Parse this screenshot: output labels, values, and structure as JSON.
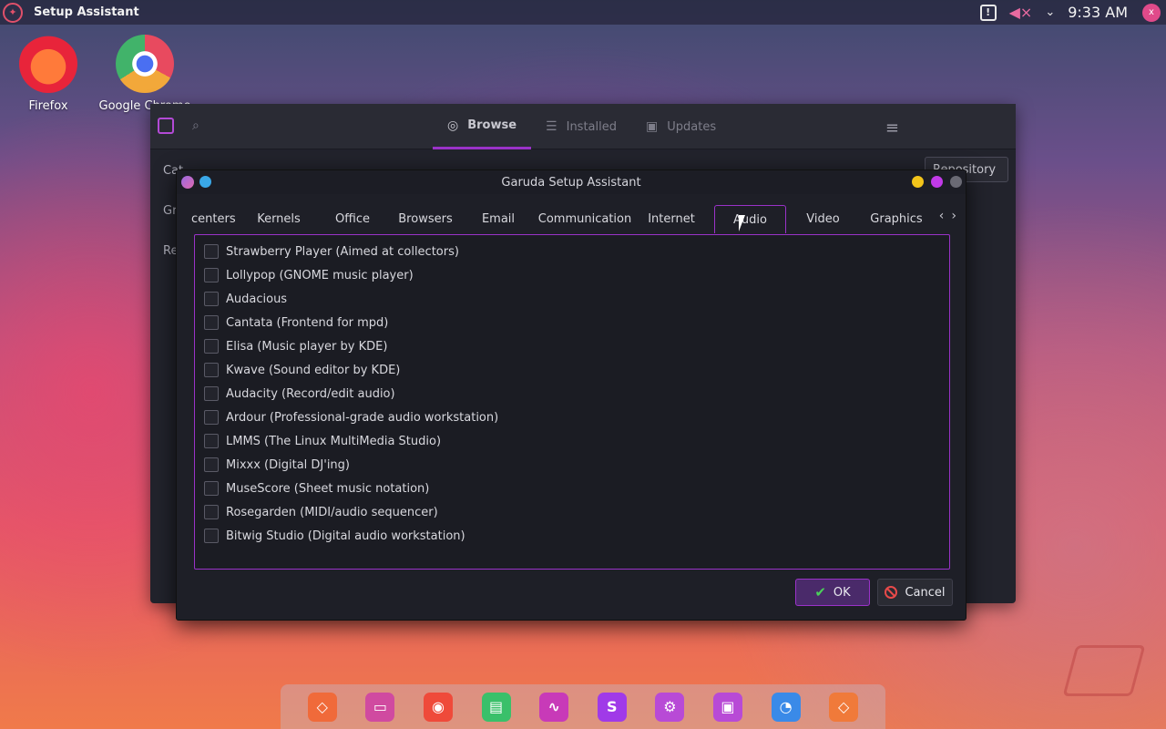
{
  "top_panel": {
    "app_title": "Setup Assistant",
    "clock": "9:33 AM",
    "user_initial": "x"
  },
  "desktop": {
    "icons": [
      {
        "label": "Firefox"
      },
      {
        "label": "Google Chrome"
      }
    ]
  },
  "bg_window": {
    "tabs": [
      {
        "label": "Browse",
        "icon": "globe-icon"
      },
      {
        "label": "Installed",
        "icon": "list-icon"
      },
      {
        "label": "Updates",
        "icon": "box-icon"
      }
    ],
    "side_items": [
      "Cat",
      "Gr",
      "Re"
    ],
    "repo_select": "Repository"
  },
  "dialog": {
    "title": "Garuda Setup Assistant",
    "tabs": [
      "centers",
      "Kernels",
      "Office",
      "Browsers",
      "Email",
      "Communication",
      "Internet",
      "Audio",
      "Video",
      "Graphics"
    ],
    "active_tab": "Audio",
    "items": [
      "Strawberry Player (Aimed at collectors)",
      "Lollypop (GNOME music player)",
      "Audacious",
      "Cantata (Frontend for mpd)",
      "Elisa (Music player by KDE)",
      "Kwave (Sound editor by KDE)",
      "Audacity (Record/edit audio)",
      "Ardour (Professional-grade audio workstation)",
      "LMMS (The Linux MultiMedia Studio)",
      "Mixxx (Digital DJ'ing)",
      "MuseScore (Sheet music notation)",
      "Rosegarden (MIDI/audio sequencer)",
      "Bitwig Studio (Digital audio workstation)"
    ],
    "ok_label": "OK",
    "cancel_label": "Cancel"
  },
  "dock": {
    "items": [
      "garuda-icon",
      "terminal-icon",
      "firefox-icon",
      "files-icon",
      "monitor-icon",
      "settings-app-icon",
      "gear-icon",
      "store-icon",
      "network-icon",
      "garuda-welcome-icon"
    ],
    "colors": [
      "#f06a3a",
      "#d04aa0",
      "#ef4a3a",
      "#3ac06a",
      "#c83ab8",
      "#a03ae8",
      "#b84ad6",
      "#b84ad6",
      "#3a8ae8",
      "#f07a3a"
    ]
  },
  "colors": {
    "accent": "#9a32c8",
    "ok_green": "#4ad05a",
    "cancel_red": "#e84a4a"
  }
}
